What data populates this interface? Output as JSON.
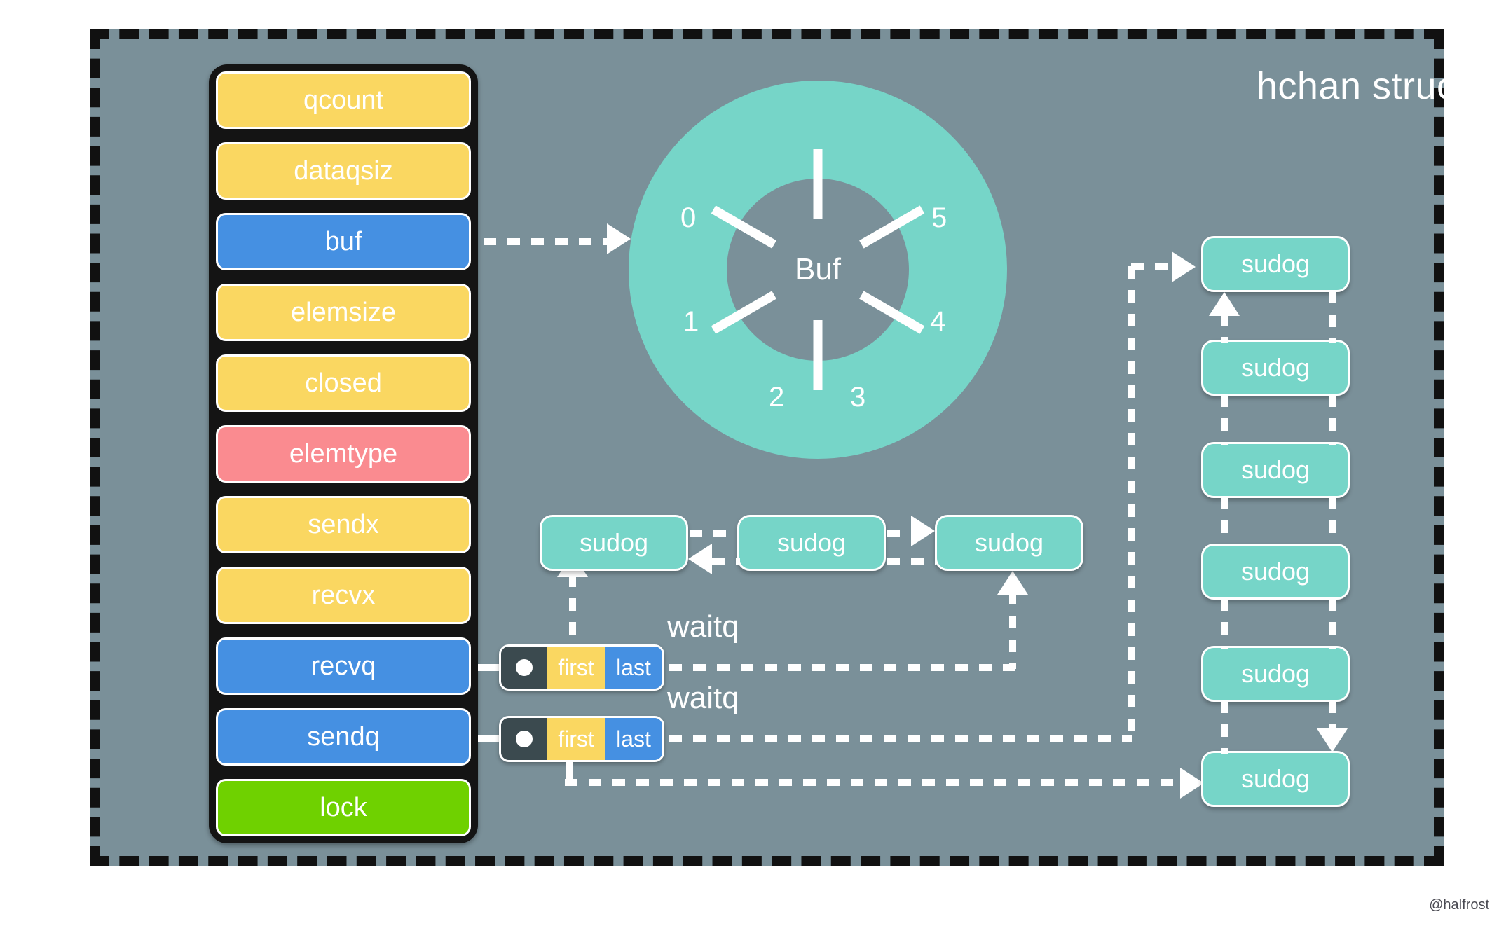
{
  "diagram": {
    "title": "hchan struct",
    "watermark": "@halfrost",
    "colors": {
      "background": "#7a9099",
      "page": "#ffffff",
      "border": "#111111",
      "yellow": "#fad761",
      "blue": "#4590e2",
      "pink": "#fa8b90",
      "green": "#6fd100",
      "teal": "#76d5c8",
      "dark": "#3b4a4f",
      "connector": "#ffffff"
    }
  },
  "struct_fields": [
    {
      "label": "qcount",
      "color": "yellow"
    },
    {
      "label": "dataqsiz",
      "color": "yellow"
    },
    {
      "label": "buf",
      "color": "blue"
    },
    {
      "label": "elemsize",
      "color": "yellow"
    },
    {
      "label": "closed",
      "color": "yellow"
    },
    {
      "label": "elemtype",
      "color": "pink"
    },
    {
      "label": "sendx",
      "color": "yellow"
    },
    {
      "label": "recvx",
      "color": "yellow"
    },
    {
      "label": "recvq",
      "color": "blue"
    },
    {
      "label": "sendq",
      "color": "blue"
    },
    {
      "label": "lock",
      "color": "green"
    }
  ],
  "buffer": {
    "center_label": "Buf",
    "slots": [
      "0",
      "1",
      "2",
      "3",
      "4",
      "5"
    ]
  },
  "recvq": {
    "waitq_label": "waitq",
    "first_label": "first",
    "last_label": "last",
    "nodes": [
      {
        "label": "sudog"
      },
      {
        "label": "sudog"
      },
      {
        "label": "sudog"
      }
    ]
  },
  "sendq": {
    "waitq_label": "waitq",
    "first_label": "first",
    "last_label": "last",
    "nodes": [
      {
        "label": "sudog"
      },
      {
        "label": "sudog"
      },
      {
        "label": "sudog"
      },
      {
        "label": "sudog"
      },
      {
        "label": "sudog"
      },
      {
        "label": "sudog"
      }
    ]
  },
  "chart_data": {
    "type": "pie",
    "title": "Buf",
    "categories": [
      "0",
      "1",
      "2",
      "3",
      "4",
      "5"
    ],
    "values": [
      1,
      1,
      1,
      1,
      1,
      1
    ],
    "legend": "none",
    "notes": "Circular ring buffer with 6 equal slots indexed 0 through 5, drawn as a donut."
  }
}
